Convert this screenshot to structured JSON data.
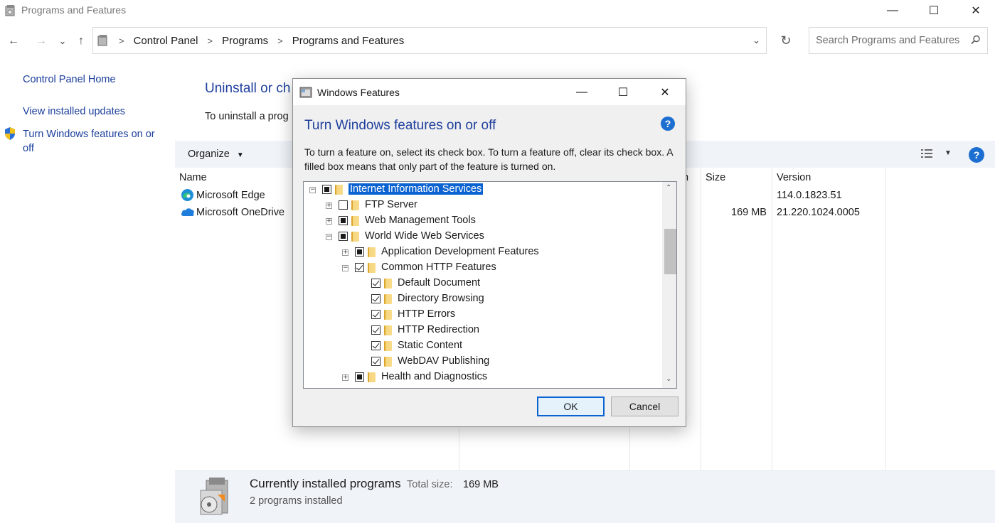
{
  "window": {
    "title": "Programs and Features",
    "controls": {
      "minimize": "—",
      "maximize": "☐",
      "close": "✕"
    }
  },
  "nav": {
    "back": "←",
    "forward": "→",
    "recent": "⌄",
    "up": "↑",
    "refresh": "↻",
    "breadcrumbs": [
      "Control Panel",
      "Programs",
      "Programs and Features"
    ],
    "search_placeholder": "Search Programs and Features"
  },
  "sidebar": {
    "items": [
      {
        "label": "Control Panel Home"
      },
      {
        "label": "View installed updates"
      },
      {
        "label": "Turn Windows features on or off",
        "icon": "shield-icon"
      }
    ]
  },
  "main": {
    "title": "Uninstall or ch",
    "subtitle": "To uninstall a prog",
    "toolbar": {
      "organize": "Organize"
    },
    "columns": {
      "name": "Name",
      "size": "Size",
      "version": "Version",
      "partial": "n"
    },
    "programs": [
      {
        "name": "Microsoft Edge",
        "size": "",
        "version": "114.0.1823.51",
        "icon": "edge-icon"
      },
      {
        "name": "Microsoft OneDrive",
        "size": "169 MB",
        "version": "21.220.1024.0005",
        "icon": "onedrive-icon"
      }
    ]
  },
  "status": {
    "title": "Currently installed programs",
    "total_label": "Total size:",
    "total_value": "169 MB",
    "count": "2 programs installed"
  },
  "dialog": {
    "title": "Windows Features",
    "heading": "Turn Windows features on or off",
    "description": "To turn a feature on, select its check box. To turn a feature off, clear its check box. A filled box means that only part of the feature is turned on.",
    "help": "?",
    "ok": "OK",
    "cancel": "Cancel",
    "features": [
      {
        "label": "Internet Information Services",
        "state": "partial",
        "expander": "minus",
        "level": 0,
        "selected": true
      },
      {
        "label": "FTP Server",
        "state": "unchecked",
        "expander": "plus",
        "level": 1
      },
      {
        "label": "Web Management Tools",
        "state": "partial",
        "expander": "plus",
        "level": 1
      },
      {
        "label": "World Wide Web Services",
        "state": "partial",
        "expander": "minus",
        "level": 1
      },
      {
        "label": "Application Development Features",
        "state": "partial",
        "expander": "plus",
        "level": 2
      },
      {
        "label": "Common HTTP Features",
        "state": "checked",
        "expander": "minus",
        "level": 2
      },
      {
        "label": "Default Document",
        "state": "checked",
        "expander": "none",
        "level": 3
      },
      {
        "label": "Directory Browsing",
        "state": "checked",
        "expander": "none",
        "level": 3
      },
      {
        "label": "HTTP Errors",
        "state": "checked",
        "expander": "none",
        "level": 3
      },
      {
        "label": "HTTP Redirection",
        "state": "checked",
        "expander": "none",
        "level": 3
      },
      {
        "label": "Static Content",
        "state": "checked",
        "expander": "none",
        "level": 3
      },
      {
        "label": "WebDAV Publishing",
        "state": "checked",
        "expander": "none",
        "level": 3
      },
      {
        "label": "Health and Diagnostics",
        "state": "partial",
        "expander": "plus",
        "level": 2
      }
    ]
  }
}
